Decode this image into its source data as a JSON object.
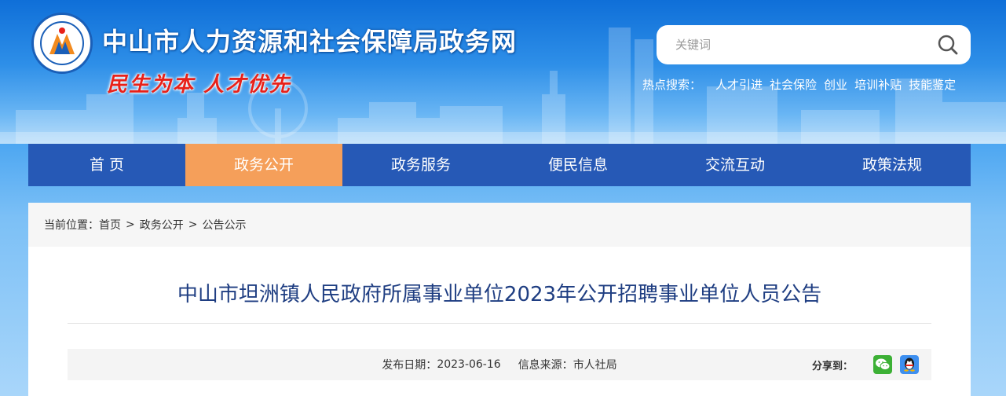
{
  "header": {
    "site_title": "中山市人力资源和社会保障局政务网",
    "slogan": "民生为本 人才优先"
  },
  "search": {
    "placeholder": "关键词",
    "value": ""
  },
  "hot_search": {
    "label": "热点搜索：",
    "links": [
      "人才引进",
      "社会保险",
      "创业",
      "培训补贴",
      "技能鉴定"
    ]
  },
  "nav": {
    "items": [
      {
        "label": "首 页"
      },
      {
        "label": "政务公开"
      },
      {
        "label": "政务服务"
      },
      {
        "label": "便民信息"
      },
      {
        "label": "交流互动"
      },
      {
        "label": "政策法规"
      }
    ],
    "active_index": 1
  },
  "breadcrumb": {
    "prefix": "当前位置：",
    "items": [
      "首页",
      "政务公开",
      "公告公示"
    ],
    "separator": ">"
  },
  "article": {
    "title": "中山市坦洲镇人民政府所属事业单位2023年公开招聘事业单位人员公告",
    "publish_label": "发布日期：",
    "publish_date": "2023-06-16",
    "source_label": "信息来源：",
    "source": "市人社局"
  },
  "share": {
    "label": "分享到：",
    "targets": [
      "wechat-icon",
      "qq-icon"
    ]
  },
  "colors": {
    "nav_bg": "#2659b6",
    "nav_active": "#f59f5a",
    "title_color": "#1f3e82",
    "slogan_color": "#e8211a"
  }
}
